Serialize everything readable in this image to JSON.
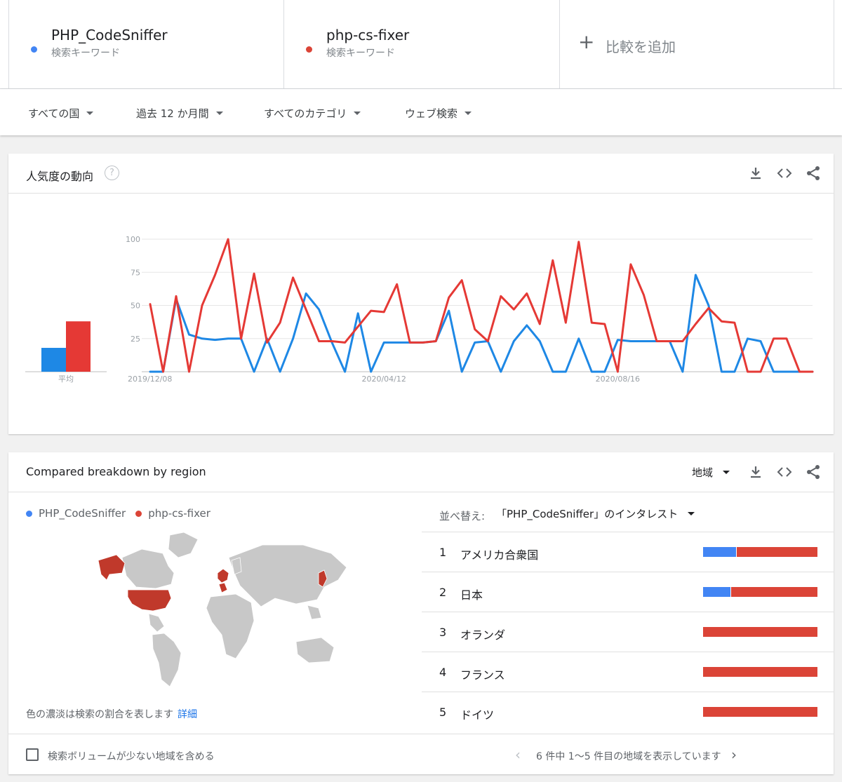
{
  "compare": {
    "terms": [
      {
        "name": "PHP_CodeSniffer",
        "type": "検索キーワード",
        "color": "#4285f4"
      },
      {
        "name": "php-cs-fixer",
        "type": "検索キーワード",
        "color": "#db4437"
      }
    ],
    "add_label": "比較を追加",
    "add_symbol": "+"
  },
  "filters": {
    "region": "すべての国",
    "period": "過去 12 か月間",
    "category": "すべてのカテゴリ",
    "property": "ウェブ検索"
  },
  "trend": {
    "title": "人気度の動向",
    "help": "?",
    "icons": [
      "download-icon",
      "embed-icon",
      "share-icon"
    ]
  },
  "chart_data": {
    "type": "line",
    "ylim": [
      0,
      100
    ],
    "y_ticks": [
      25,
      50,
      75,
      100
    ],
    "x_labels": [
      "2019/12/08",
      "2020/04/12",
      "2020/08/16"
    ],
    "average_label": "平均",
    "average": [
      18,
      38
    ],
    "series": [
      {
        "name": "PHP_CodeSniffer",
        "color": "#1e88e5",
        "values": [
          0,
          0,
          55,
          28,
          25,
          24,
          25,
          25,
          0,
          25,
          0,
          25,
          59,
          47,
          22,
          0,
          44,
          0,
          22,
          22,
          22,
          22,
          23,
          46,
          0,
          22,
          23,
          0,
          23,
          35,
          23,
          0,
          0,
          25,
          0,
          0,
          24,
          23,
          23,
          23,
          23,
          0,
          73,
          50,
          0,
          0,
          25,
          23,
          0,
          0,
          0,
          0
        ]
      },
      {
        "name": "php-cs-fixer",
        "color": "#e53935",
        "values": [
          51,
          0,
          57,
          0,
          50,
          73,
          100,
          25,
          74,
          22,
          37,
          71,
          47,
          23,
          23,
          22,
          34,
          46,
          45,
          66,
          22,
          22,
          23,
          56,
          69,
          32,
          23,
          57,
          47,
          59,
          36,
          84,
          37,
          98,
          37,
          36,
          0,
          81,
          58,
          23,
          23,
          23,
          36,
          48,
          38,
          37,
          0,
          0,
          25,
          25,
          0,
          0
        ]
      }
    ]
  },
  "region": {
    "title": "Compared breakdown by region",
    "resolution": "地域",
    "legend": [
      "PHP_CodeSniffer",
      "php-cs-fixer"
    ],
    "sort_label": "並べ替え:",
    "sort_value": "「PHP_CodeSniffer」のインタレスト",
    "map_note": "色の濃淡は検索の割合を表します",
    "map_link": "詳細",
    "rows": [
      {
        "rank": "1",
        "name": "アメリカ合衆国",
        "share_a": 0.29
      },
      {
        "rank": "2",
        "name": "日本",
        "share_a": 0.24
      },
      {
        "rank": "3",
        "name": "オランダ",
        "share_a": 0
      },
      {
        "rank": "4",
        "name": "フランス",
        "share_a": 0
      },
      {
        "rank": "5",
        "name": "ドイツ",
        "share_a": 0
      }
    ],
    "include_low_volume": "検索ボリュームが少ない地域を含める",
    "pager_text": "6 件中 1〜5 件目の地域を表示しています"
  }
}
